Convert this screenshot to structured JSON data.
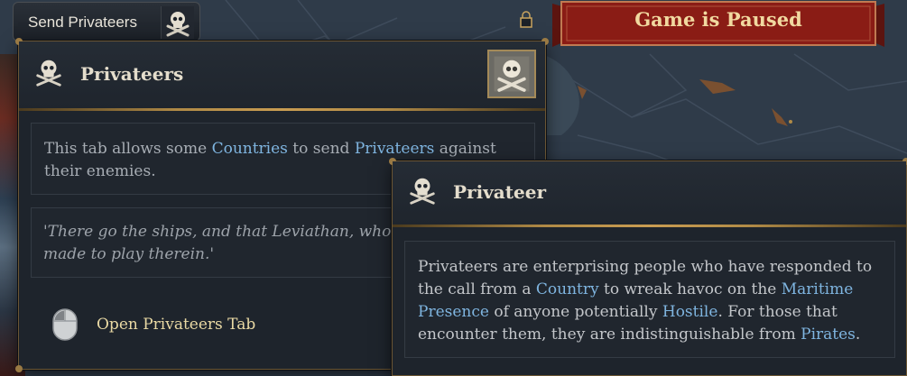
{
  "send_button": {
    "label": "Send Privateers",
    "icon": "skull-crossbones-icon"
  },
  "pause_banner": {
    "label": "Game is Paused"
  },
  "privateers_tooltip": {
    "title": "Privateers",
    "header_icon": "skull-crossbones-icon",
    "badge_icon": "skull-crossbones-icon",
    "description": {
      "part1": "This tab allows some ",
      "kw1": "Countries",
      "part2": " to send ",
      "kw2": "Privateers",
      "part3": " against their enemies."
    },
    "quote": "'There go the ships, and that Leviathan, whom thou hast made to play therein.'",
    "action": {
      "icon": "mouse-icon",
      "label": "Open Privateers Tab"
    }
  },
  "privateer_tooltip": {
    "title": "Privateer",
    "header_icon": "skull-crossbones-icon",
    "body": {
      "p1": "Privateers are enterprising people who have responded to the call from a ",
      "kw1": "Country",
      "p2": " to wreak havoc on the ",
      "kw2": "Maritime Presence",
      "p3": " of anyone potentially ",
      "kw3": "Hostile",
      "p4": ". For those that encounter them, they are indistinguishable from ",
      "kw4": "Pirates",
      "p5": "."
    }
  },
  "colors": {
    "keyword": "#7fb5e0",
    "gold_trim": "#c99d52",
    "banner_red": "#8c1d16",
    "panel_bg": "#1e242c"
  }
}
